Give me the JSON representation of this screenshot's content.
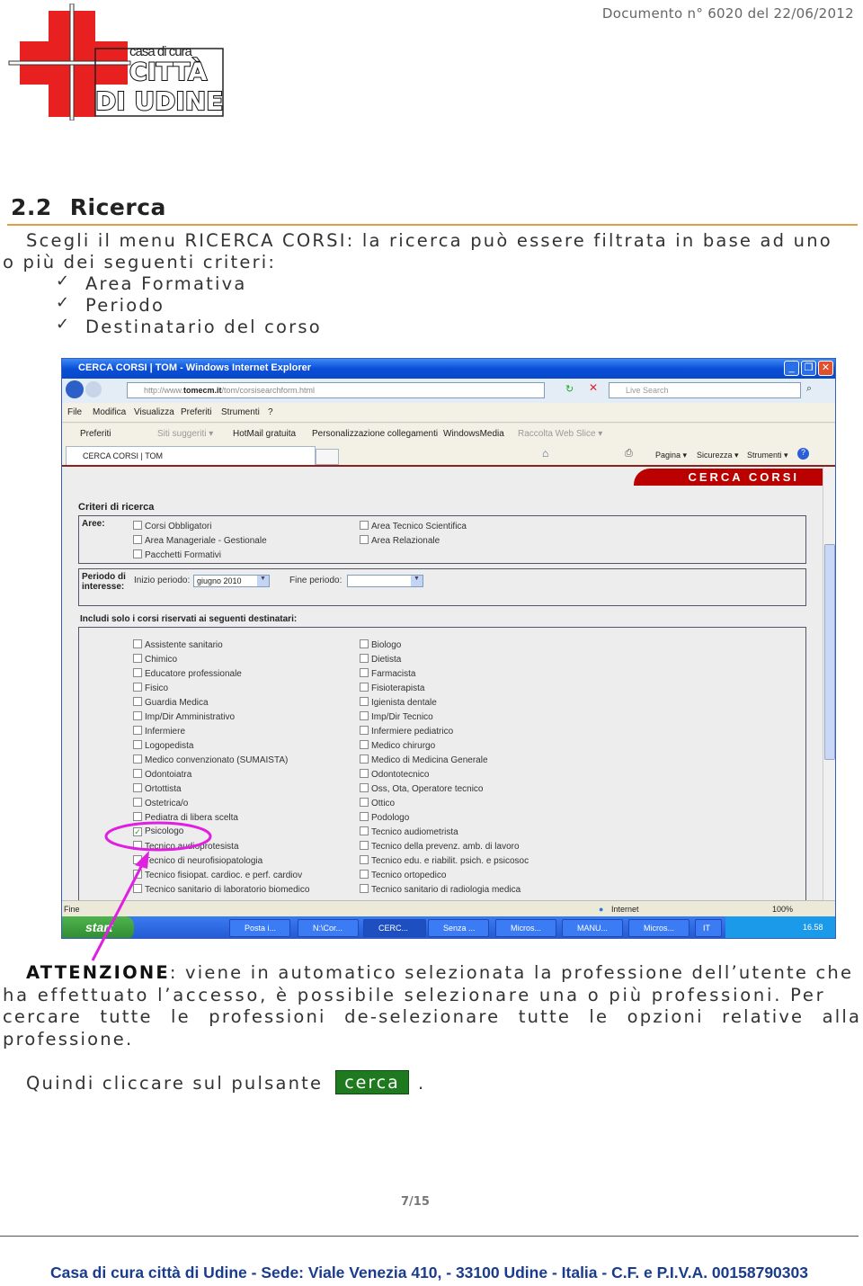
{
  "header": {
    "document_number": "Documento n° 6020 del 22/06/2012",
    "logo_text": "casa di cura CITTÀ DI UDINE"
  },
  "section": {
    "number": "2.2",
    "title": "Ricerca"
  },
  "intro": {
    "line1": "Scegli il menu RICERCA CORSI: la ricerca può essere filtrata in base ad uno",
    "line2": "o più dei seguenti criteri:",
    "criteria": [
      "Area Formativa",
      "Periodo",
      "Destinatario del corso"
    ],
    "check_glyph": "✓"
  },
  "browser": {
    "window_title": "CERCA CORSI | TOM - Windows Internet Explorer",
    "url_prefix": "http://www.",
    "url_domain": "tomecm.it",
    "url_path": "/tom/corsisearchform.html",
    "search_placeholder": "Live Search",
    "menu": [
      "File",
      "Modifica",
      "Visualizza",
      "Preferiti",
      "Strumenti",
      "?"
    ],
    "favorites": [
      "Preferiti",
      "Siti suggeriti ▾",
      "HotMail gratuita",
      "Personalizzazione collegamenti",
      "WindowsMedia",
      "Raccolta Web Slice ▾"
    ],
    "tab_label": "CERCA CORSI | TOM",
    "tools": [
      "Pagina ▾",
      "Sicurezza ▾",
      "Strumenti ▾"
    ],
    "status_left": "Fine",
    "status_zone": "Internet",
    "zoom": "100%",
    "taskbar": {
      "start": "start",
      "items": [
        "Posta i...",
        "N:\\Cor...",
        "CERC...",
        "Senza ...",
        "Micros...",
        "MANU...",
        "Micros..."
      ],
      "lang": "IT",
      "clock": "16.58"
    }
  },
  "form": {
    "banner": "CERCA CORSI",
    "criteria_title": "Criteri di ricerca",
    "areas_label": "Aree:",
    "areas_left": [
      "Corsi Obbligatori",
      "Area Manageriale - Gestionale",
      "Pacchetti Formativi"
    ],
    "areas_right": [
      "Area Tecnico Scientifica",
      "Area Relazionale"
    ],
    "period_label": "Periodo di interesse:",
    "start_label": "Inizio periodo:",
    "start_value": "giugno 2010",
    "end_label": "Fine periodo:",
    "end_value": "",
    "recipients_title": "Includi solo i corsi riservati ai seguenti destinatari:",
    "recipients_left": [
      "Assistente sanitario",
      "Chimico",
      "Educatore professionale",
      "Fisico",
      "Guardia Medica",
      "Imp/Dir Amministrativo",
      "Infermiere",
      "Logopedista",
      "Medico convenzionato (SUMAISTA)",
      "Odontoiatra",
      "Ortottista",
      "Ostetrica/o",
      "Pediatra di libera scelta",
      "Psicologo",
      "Tecnico audioprotesista",
      "Tecnico di neurofisiopatologia",
      "Tecnico fisiopat. cardioc. e perf. cardiov",
      "Tecnico sanitario di laboratorio biomedico"
    ],
    "recipients_right": [
      "Biologo",
      "Dietista",
      "Farmacista",
      "Fisioterapista",
      "Igienista dentale",
      "Imp/Dir Tecnico",
      "Infermiere pediatrico",
      "Medico chirurgo",
      "Medico di Medicina Generale",
      "Odontotecnico",
      "Oss, Ota, Operatore tecnico",
      "Ottico",
      "Podologo",
      "Tecnico audiometrista",
      "Tecnico della prevenz. amb. di lavoro",
      "Tecnico edu. e riabilit. psich. e psicosoc",
      "Tecnico ortopedico",
      "Tecnico sanitario di radiologia medica"
    ],
    "checked": "Psicologo"
  },
  "attention": {
    "label": "ATTENZIONE",
    "line1": ": viene in automatico selezionata la professione dell’utente che",
    "line2": "ha effettuato l’accesso, è possibile selezionare una o più professioni. Per",
    "line3": "cercare tutte le professioni de-selezionare tutte le opzioni relative alla",
    "line4": "professione."
  },
  "closing": {
    "text": "Quindi cliccare sul pulsante",
    "button": "cerca",
    "period": "."
  },
  "page": "7/15",
  "footer": "Casa di cura città di Udine - Sede: Viale Venezia 410, - 33100 Udine - Italia - C.F. e P.I.V.A. 00158790303",
  "colors": {
    "accent_heading_rule": "#e0a040",
    "annotation": "#e020e0",
    "button_green": "#1f7a1f",
    "footer_blue": "#1a3c8c",
    "banner_red": "#bb0000"
  }
}
